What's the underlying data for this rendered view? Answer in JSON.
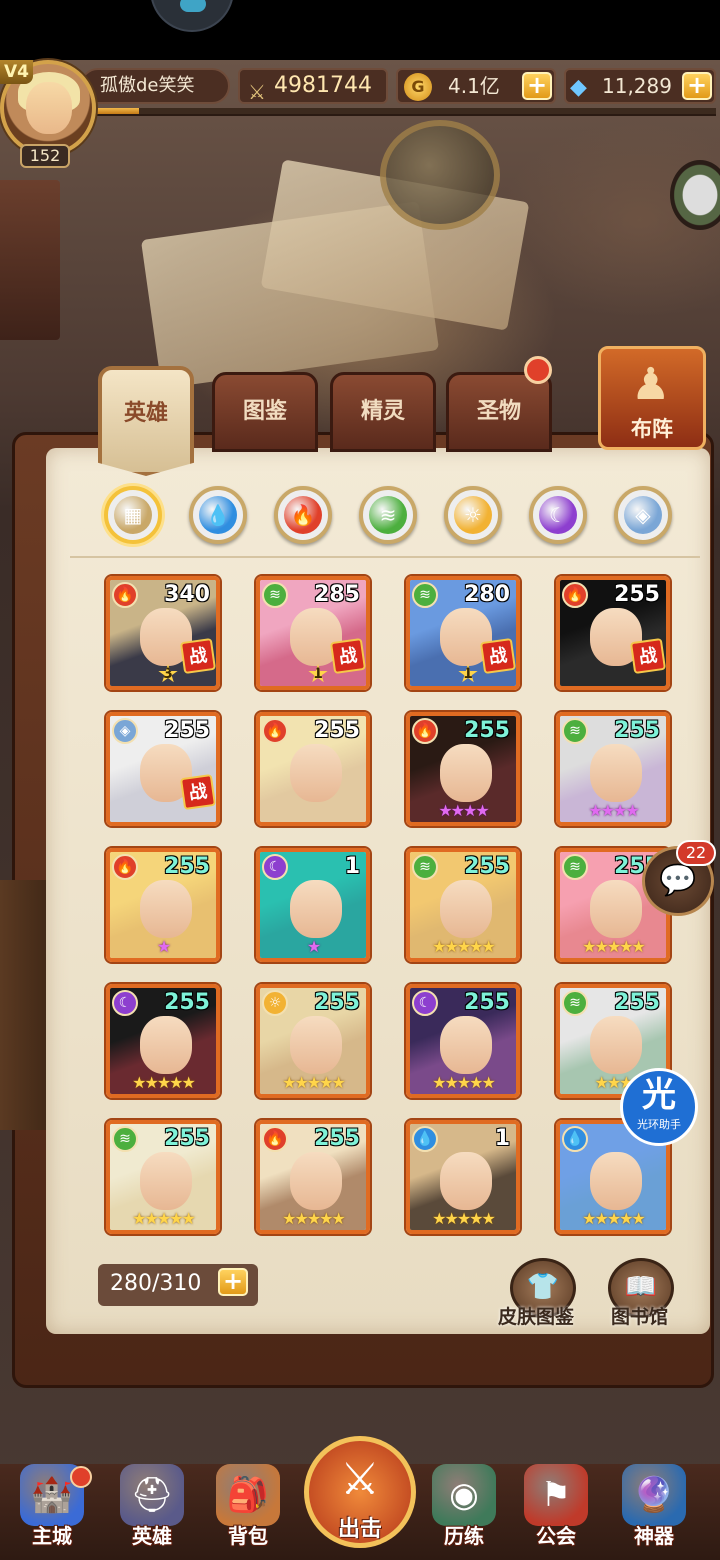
{
  "header": {
    "vip": "V4",
    "player_level": "152",
    "player_name": "孤傲de笑笑",
    "power": "4981744",
    "gold": "4.1亿",
    "gems": "11,289",
    "xp_fraction": 0.07
  },
  "tabs": [
    {
      "label": "英雄",
      "active": true
    },
    {
      "label": "图鉴",
      "active": false
    },
    {
      "label": "精灵",
      "active": false
    },
    {
      "label": "圣物",
      "active": false
    }
  ],
  "formation_label": "布阵",
  "element_filters": [
    "all",
    "water",
    "fire",
    "wind",
    "light",
    "dark",
    "void"
  ],
  "heroes": [
    {
      "level": "340",
      "element": "fire",
      "stars": 3,
      "star_style": "wing",
      "in_battle": true
    },
    {
      "level": "285",
      "element": "wind",
      "stars": 1,
      "star_style": "wing",
      "in_battle": true
    },
    {
      "level": "280",
      "element": "wind",
      "stars": 1,
      "star_style": "wing",
      "in_battle": true
    },
    {
      "level": "255",
      "element": "fire",
      "stars": 0,
      "star_style": "wing",
      "in_battle": true
    },
    {
      "level": "255",
      "element": "void",
      "stars": 0,
      "star_style": "gold",
      "in_battle": true
    },
    {
      "level": "255",
      "element": "fire",
      "stars": 0,
      "star_style": "gold",
      "in_battle": false
    },
    {
      "level": "255",
      "element": "fire",
      "stars": 4,
      "star_style": "purple",
      "in_battle": false
    },
    {
      "level": "255",
      "element": "wind",
      "stars": 4,
      "star_style": "purple",
      "in_battle": false
    },
    {
      "level": "255",
      "element": "fire",
      "stars": 1,
      "star_style": "purple",
      "in_battle": false
    },
    {
      "level": "1",
      "element": "dark",
      "stars": 1,
      "star_style": "purple",
      "in_battle": false
    },
    {
      "level": "255",
      "element": "wind",
      "stars": 5,
      "star_style": "gold",
      "in_battle": false
    },
    {
      "level": "255",
      "element": "wind",
      "stars": 5,
      "star_style": "gold",
      "in_battle": false
    },
    {
      "level": "255",
      "element": "dark",
      "stars": 5,
      "star_style": "gold",
      "in_battle": false
    },
    {
      "level": "255",
      "element": "light",
      "stars": 5,
      "star_style": "gold",
      "in_battle": false
    },
    {
      "level": "255",
      "element": "dark",
      "stars": 5,
      "star_style": "gold",
      "in_battle": false
    },
    {
      "level": "255",
      "element": "wind",
      "stars": 3,
      "star_style": "gold",
      "in_battle": false
    },
    {
      "level": "255",
      "element": "wind",
      "stars": 5,
      "star_style": "gold",
      "in_battle": false
    },
    {
      "level": "255",
      "element": "fire",
      "stars": 5,
      "star_style": "gold",
      "in_battle": false
    },
    {
      "level": "1",
      "element": "water",
      "stars": 5,
      "star_style": "gold",
      "in_battle": false
    },
    {
      "level": "",
      "element": "water",
      "stars": 5,
      "star_style": "gold",
      "in_battle": false
    }
  ],
  "battle_mark": "战",
  "hero_count": "280/310",
  "skin_gallery_label": "皮肤图鉴",
  "library_label": "图书馆",
  "chat_badge": "22",
  "assistant": {
    "glyph": "光",
    "label": "光环助手"
  },
  "nav": [
    {
      "label": "主城",
      "icon": "castle-icon",
      "dot": true
    },
    {
      "label": "英雄",
      "icon": "helmet-icon",
      "dot": false
    },
    {
      "label": "背包",
      "icon": "backpack-icon",
      "dot": false
    },
    {
      "label": "出击",
      "icon": "crossed-swords-icon",
      "dot": false
    },
    {
      "label": "历练",
      "icon": "training-icon",
      "dot": false
    },
    {
      "label": "公会",
      "icon": "guild-icon",
      "dot": false
    },
    {
      "label": "神器",
      "icon": "artifact-icon",
      "dot": false
    }
  ],
  "colors": {
    "water": "#2f8ee0",
    "fire": "#e0402a",
    "wind": "#4caf3e",
    "light": "#f2b233",
    "dark": "#8d3fcf",
    "void": "#7aa6d6",
    "all": "#c9a868"
  }
}
